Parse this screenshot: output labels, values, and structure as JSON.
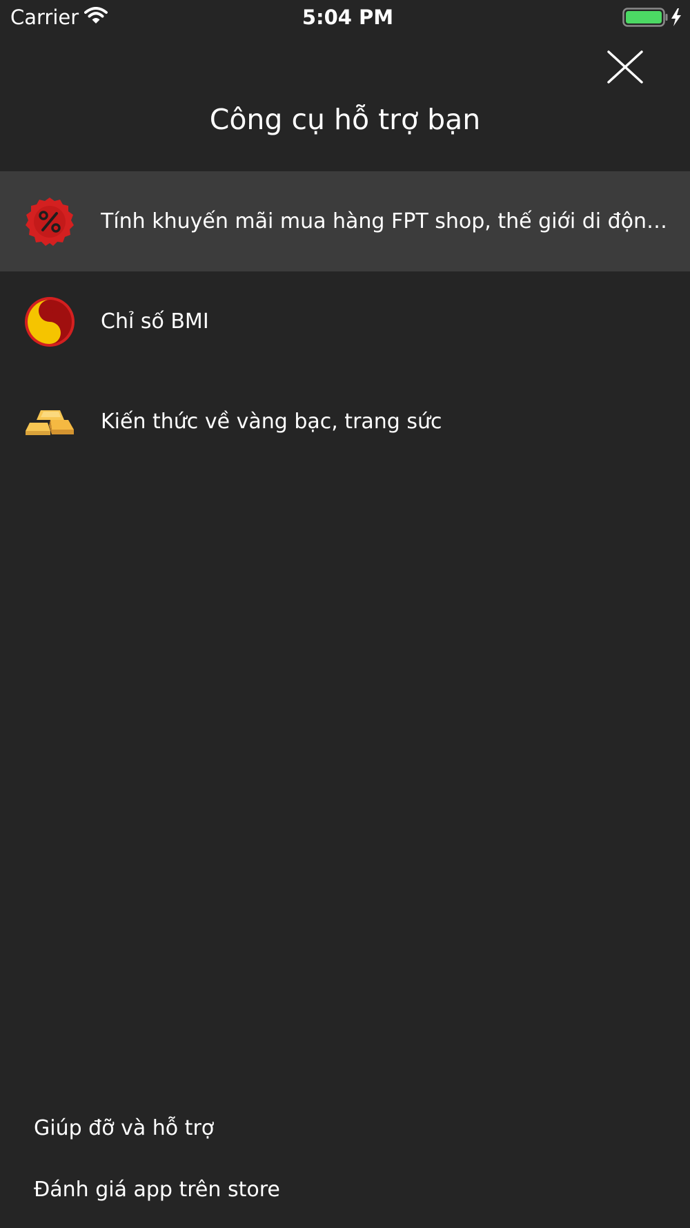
{
  "status_bar": {
    "carrier": "Carrier",
    "time": "5:04 PM",
    "battery_color": "#4cd964"
  },
  "header": {
    "title": "Công cụ hỗ trợ bạn",
    "close_icon": "close-icon"
  },
  "menu": {
    "items": [
      {
        "label": "Tính khuyến mãi mua hàng FPT shop, thế giới di động…",
        "icon": "discount-percent-icon",
        "active": true
      },
      {
        "label": "Chỉ số BMI",
        "icon": "yin-yang-icon",
        "active": false
      },
      {
        "label": "Kiến thức về vàng bạc, trang sức",
        "icon": "gold-bars-icon",
        "active": false
      }
    ]
  },
  "footer": {
    "help_label": "Giúp đỡ và hỗ trợ",
    "rate_label": "Đánh giá app trên store"
  },
  "colors": {
    "background": "#252525",
    "active_row": "#3c3c3c",
    "text": "#ffffff",
    "discount_red": "#d42020",
    "yin_yang_yellow": "#f5c400",
    "yin_yang_red": "#a00f0f",
    "gold": "#f7c653"
  }
}
